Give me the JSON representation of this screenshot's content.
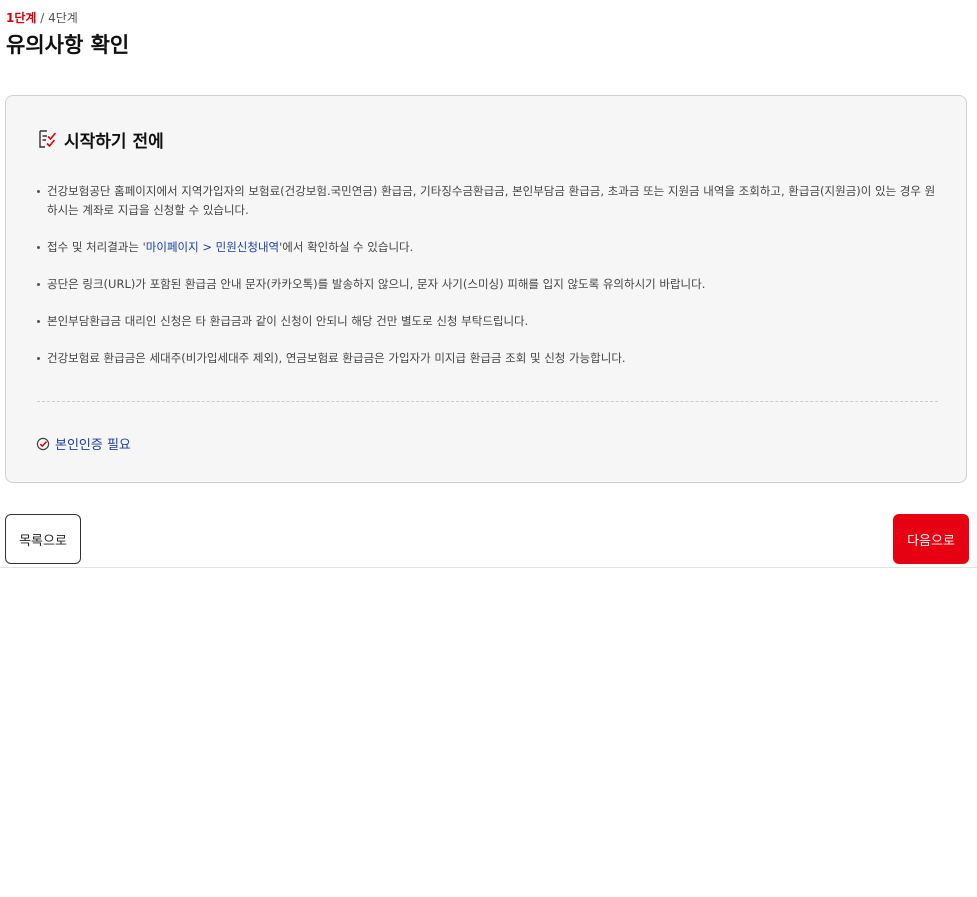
{
  "step": {
    "current": "1단계",
    "separator": " / ",
    "total": "4단계"
  },
  "page_title": "유의사항 확인",
  "notice": {
    "icon": "checklist-icon",
    "title": "시작하기 전에",
    "items": [
      {
        "before": "건강보험공단 홈페이지에서 지역가입자의 보험료(건강보험.국민연금) 환급금, 기타징수금환급금, 본인부담금 환급금, 초과금 또는 지원금 내역을 조회하고, 환급금(지원금)이 있는 경우 원하시는 계좌로 지급을 신청할 수 있습니다.",
        "link": "",
        "after": ""
      },
      {
        "before": "접수 및 처리결과는 '",
        "link": "마이페이지 > 민원신청내역",
        "after": "'에서 확인하실 수 있습니다."
      },
      {
        "before": "공단은 링크(URL)가 포함된 환급금 안내 문자(카카오톡)를 발송하지 않으니, 문자 사기(스미싱) 피해를 입지 않도록 유의하시기 바랍니다.",
        "link": "",
        "after": ""
      },
      {
        "before": "본인부담환급금 대리인 신청은 타 환급금과 같이 신청이 안되니 해당 건만 별도로 신청 부탁드립니다.",
        "link": "",
        "after": ""
      },
      {
        "before": "건강보험료 환급금은 세대주(비가입세대주 제외), 연금보험료 환급금은 가입자가 미지급 환급금 조회 및 신청 가능합니다.",
        "link": "",
        "after": ""
      }
    ],
    "auth_icon": "check-circle-icon",
    "auth_label": "본인인증 필요"
  },
  "buttons": {
    "list_label": "목록으로",
    "next_label": "다음으로"
  },
  "colors": {
    "accent_red": "#e60012",
    "step_red": "#d7000f",
    "link_blue": "#1a3f9e",
    "box_bg": "#f6f6f6"
  }
}
